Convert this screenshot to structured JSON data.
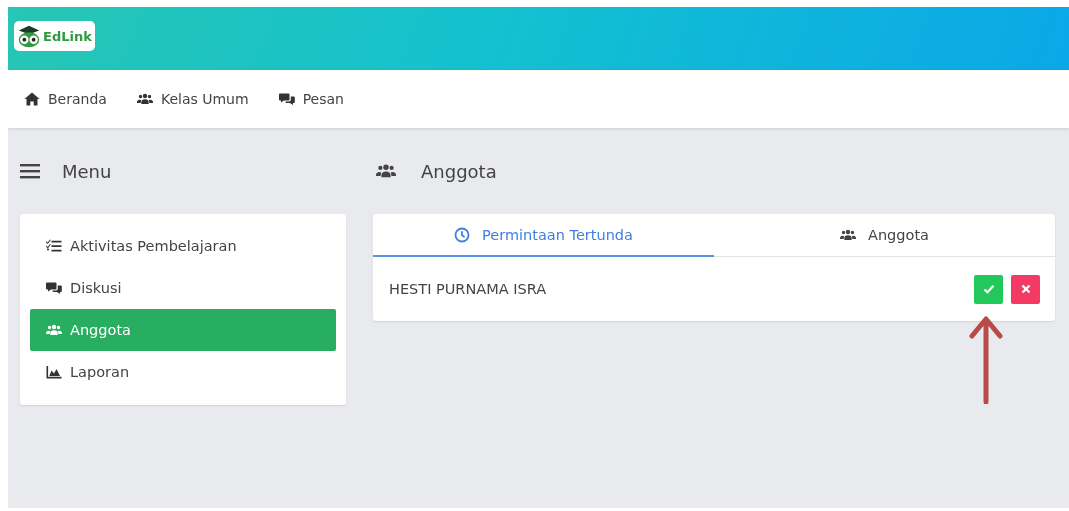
{
  "logo": {
    "text": "EdLink"
  },
  "nav": [
    {
      "label": "Beranda"
    },
    {
      "label": "Kelas Umum"
    },
    {
      "label": "Pesan"
    }
  ],
  "menu": {
    "title": "Menu",
    "items": [
      {
        "label": "Aktivitas Pembelajaran",
        "selected": false
      },
      {
        "label": "Diskusi",
        "selected": false
      },
      {
        "label": "Anggota",
        "selected": true
      },
      {
        "label": "Laporan",
        "selected": false
      }
    ]
  },
  "panel": {
    "title": "Anggota",
    "tabs": [
      {
        "label": "Permintaan Tertunda",
        "selected": true
      },
      {
        "label": "Anggota",
        "selected": false
      }
    ],
    "requests": [
      {
        "name": "HESTI PURNAMA ISRA"
      }
    ]
  }
}
